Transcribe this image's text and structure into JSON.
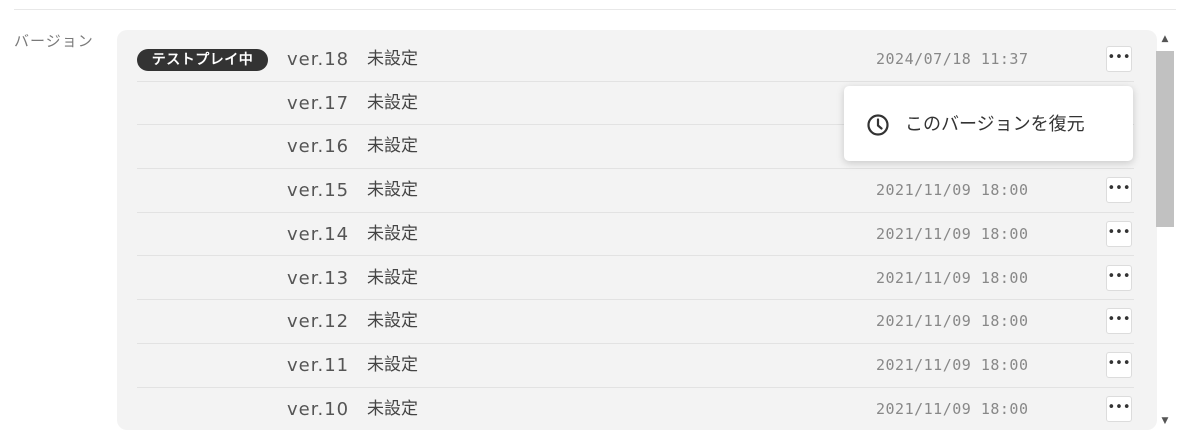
{
  "section": {
    "label": "バージョン"
  },
  "badge": {
    "label": "テストプレイ中"
  },
  "versions": [
    {
      "ver": "ver.18",
      "name": "未設定",
      "date": "2024/07/18 11:37"
    },
    {
      "ver": "ver.17",
      "name": "未設定",
      "date": ""
    },
    {
      "ver": "ver.16",
      "name": "未設定",
      "date": ""
    },
    {
      "ver": "ver.15",
      "name": "未設定",
      "date": "2021/11/09 18:00"
    },
    {
      "ver": "ver.14",
      "name": "未設定",
      "date": "2021/11/09 18:00"
    },
    {
      "ver": "ver.13",
      "name": "未設定",
      "date": "2021/11/09 18:00"
    },
    {
      "ver": "ver.12",
      "name": "未設定",
      "date": "2021/11/09 18:00"
    },
    {
      "ver": "ver.11",
      "name": "未設定",
      "date": "2021/11/09 18:00"
    },
    {
      "ver": "ver.10",
      "name": "未設定",
      "date": "2021/11/09 18:00"
    }
  ],
  "more_button": {
    "label": "•••"
  },
  "popup": {
    "label": "このバージョンを復元",
    "icon": "clock-icon"
  },
  "scrollbar": {
    "up": "▲",
    "down": "▼"
  }
}
